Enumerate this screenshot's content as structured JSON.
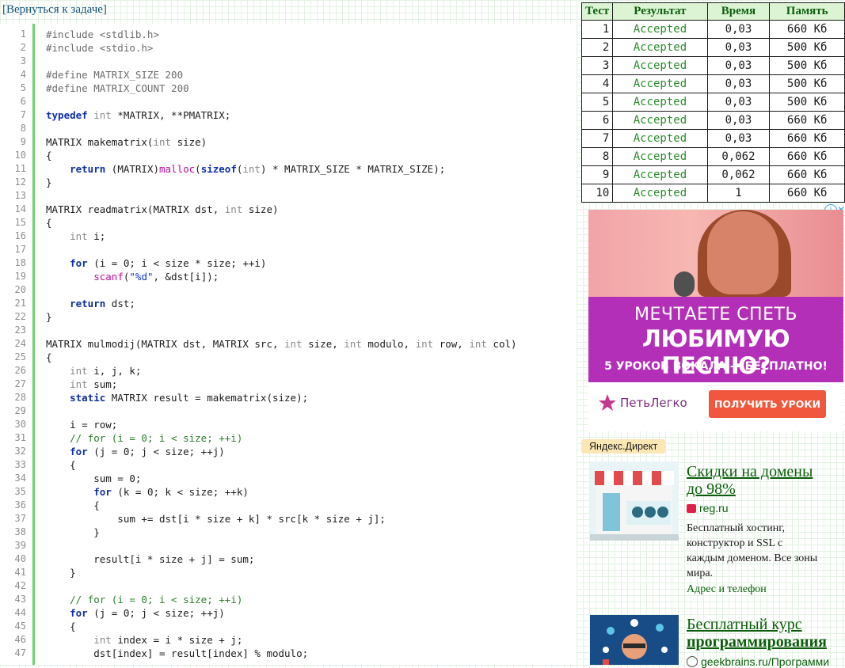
{
  "back_link": "[Вернуться к задаче]",
  "code": {
    "lines": [
      {
        "n": "1",
        "t": [
          {
            "c": "pp",
            "v": "#include <stdlib.h>"
          }
        ]
      },
      {
        "n": "2",
        "t": [
          {
            "c": "pp",
            "v": "#include <stdio.h>"
          }
        ]
      },
      {
        "n": "3",
        "t": []
      },
      {
        "n": "4",
        "t": [
          {
            "c": "pp",
            "v": "#define MATRIX_SIZE 200"
          }
        ]
      },
      {
        "n": "5",
        "t": [
          {
            "c": "pp",
            "v": "#define MATRIX_COUNT 200"
          }
        ]
      },
      {
        "n": "6",
        "t": []
      },
      {
        "n": "7",
        "t": [
          {
            "c": "kw",
            "v": "typedef"
          },
          {
            "c": "",
            "v": " "
          },
          {
            "c": "ty",
            "v": "int"
          },
          {
            "c": "",
            "v": " *MATRIX, **PMATRIX;"
          }
        ]
      },
      {
        "n": "8",
        "t": []
      },
      {
        "n": "9",
        "t": [
          {
            "c": "",
            "v": "MATRIX makematrix("
          },
          {
            "c": "ty",
            "v": "int"
          },
          {
            "c": "",
            "v": " size)"
          }
        ]
      },
      {
        "n": "10",
        "t": [
          {
            "c": "",
            "v": "{"
          }
        ]
      },
      {
        "n": "11",
        "t": [
          {
            "c": "",
            "v": "    "
          },
          {
            "c": "kw",
            "v": "return"
          },
          {
            "c": "",
            "v": " (MATRIX)"
          },
          {
            "c": "fn",
            "v": "malloc"
          },
          {
            "c": "",
            "v": "("
          },
          {
            "c": "kw",
            "v": "sizeof"
          },
          {
            "c": "",
            "v": "("
          },
          {
            "c": "ty",
            "v": "int"
          },
          {
            "c": "",
            "v": ") * MATRIX_SIZE * MATRIX_SIZE);"
          }
        ]
      },
      {
        "n": "12",
        "t": [
          {
            "c": "",
            "v": "}"
          }
        ]
      },
      {
        "n": "13",
        "t": []
      },
      {
        "n": "14",
        "t": [
          {
            "c": "",
            "v": "MATRIX readmatrix(MATRIX dst, "
          },
          {
            "c": "ty",
            "v": "int"
          },
          {
            "c": "",
            "v": " size)"
          }
        ]
      },
      {
        "n": "15",
        "t": [
          {
            "c": "",
            "v": "{"
          }
        ]
      },
      {
        "n": "16",
        "t": [
          {
            "c": "",
            "v": "    "
          },
          {
            "c": "ty",
            "v": "int"
          },
          {
            "c": "",
            "v": " i;"
          }
        ]
      },
      {
        "n": "17",
        "t": []
      },
      {
        "n": "18",
        "t": [
          {
            "c": "",
            "v": "    "
          },
          {
            "c": "kw",
            "v": "for"
          },
          {
            "c": "",
            "v": " (i = 0; i < size * size; ++i)"
          }
        ]
      },
      {
        "n": "19",
        "t": [
          {
            "c": "",
            "v": "        "
          },
          {
            "c": "fn",
            "v": "scanf"
          },
          {
            "c": "",
            "v": "("
          },
          {
            "c": "str",
            "v": "\"%d\""
          },
          {
            "c": "",
            "v": ", &dst[i]);"
          }
        ]
      },
      {
        "n": "20",
        "t": []
      },
      {
        "n": "21",
        "t": [
          {
            "c": "",
            "v": "    "
          },
          {
            "c": "kw",
            "v": "return"
          },
          {
            "c": "",
            "v": " dst;"
          }
        ]
      },
      {
        "n": "22",
        "t": [
          {
            "c": "",
            "v": "}"
          }
        ]
      },
      {
        "n": "23",
        "t": []
      },
      {
        "n": "24",
        "t": [
          {
            "c": "",
            "v": "MATRIX mulmodij(MATRIX dst, MATRIX src, "
          },
          {
            "c": "ty",
            "v": "int"
          },
          {
            "c": "",
            "v": " size, "
          },
          {
            "c": "ty",
            "v": "int"
          },
          {
            "c": "",
            "v": " modulo, "
          },
          {
            "c": "ty",
            "v": "int"
          },
          {
            "c": "",
            "v": " row, "
          },
          {
            "c": "ty",
            "v": "int"
          },
          {
            "c": "",
            "v": " col)"
          }
        ]
      },
      {
        "n": "25",
        "t": [
          {
            "c": "",
            "v": "{"
          }
        ]
      },
      {
        "n": "26",
        "t": [
          {
            "c": "",
            "v": "    "
          },
          {
            "c": "ty",
            "v": "int"
          },
          {
            "c": "",
            "v": " i, j, k;"
          }
        ]
      },
      {
        "n": "27",
        "t": [
          {
            "c": "",
            "v": "    "
          },
          {
            "c": "ty",
            "v": "int"
          },
          {
            "c": "",
            "v": " sum;"
          }
        ]
      },
      {
        "n": "28",
        "t": [
          {
            "c": "",
            "v": "    "
          },
          {
            "c": "kw",
            "v": "static"
          },
          {
            "c": "",
            "v": " MATRIX result = makematrix(size);"
          }
        ]
      },
      {
        "n": "29",
        "t": []
      },
      {
        "n": "30",
        "t": [
          {
            "c": "",
            "v": "    i = row;"
          }
        ]
      },
      {
        "n": "31",
        "t": [
          {
            "c": "",
            "v": "    "
          },
          {
            "c": "cm",
            "v": "// for (i = 0; i < size; ++i)"
          }
        ]
      },
      {
        "n": "32",
        "t": [
          {
            "c": "",
            "v": "    "
          },
          {
            "c": "kw",
            "v": "for"
          },
          {
            "c": "",
            "v": " (j = 0; j < size; ++j)"
          }
        ]
      },
      {
        "n": "33",
        "t": [
          {
            "c": "",
            "v": "    {"
          }
        ]
      },
      {
        "n": "34",
        "t": [
          {
            "c": "",
            "v": "        sum = 0;"
          }
        ]
      },
      {
        "n": "35",
        "t": [
          {
            "c": "",
            "v": "        "
          },
          {
            "c": "kw",
            "v": "for"
          },
          {
            "c": "",
            "v": " (k = 0; k < size; ++k)"
          }
        ]
      },
      {
        "n": "36",
        "t": [
          {
            "c": "",
            "v": "        {"
          }
        ]
      },
      {
        "n": "37",
        "t": [
          {
            "c": "",
            "v": "            sum += dst[i * size + k] * src[k * size + j];"
          }
        ]
      },
      {
        "n": "38",
        "t": [
          {
            "c": "",
            "v": "        }"
          }
        ]
      },
      {
        "n": "39",
        "t": []
      },
      {
        "n": "40",
        "t": [
          {
            "c": "",
            "v": "        result[i * size + j] = sum;"
          }
        ]
      },
      {
        "n": "41",
        "t": [
          {
            "c": "",
            "v": "    }"
          }
        ]
      },
      {
        "n": "42",
        "t": []
      },
      {
        "n": "43",
        "t": [
          {
            "c": "",
            "v": "    "
          },
          {
            "c": "cm",
            "v": "// for (i = 0; i < size; ++i)"
          }
        ]
      },
      {
        "n": "44",
        "t": [
          {
            "c": "",
            "v": "    "
          },
          {
            "c": "kw",
            "v": "for"
          },
          {
            "c": "",
            "v": " (j = 0; j < size; ++j)"
          }
        ]
      },
      {
        "n": "45",
        "t": [
          {
            "c": "",
            "v": "    {"
          }
        ]
      },
      {
        "n": "46",
        "t": [
          {
            "c": "",
            "v": "        "
          },
          {
            "c": "ty",
            "v": "int"
          },
          {
            "c": "",
            "v": " index = i * size + j;"
          }
        ]
      },
      {
        "n": "47",
        "t": [
          {
            "c": "",
            "v": "        dst[index] = result[index] % modulo;"
          }
        ]
      }
    ]
  },
  "results": {
    "headers": [
      "Тест",
      "Результат",
      "Время",
      "Память"
    ],
    "rows": [
      [
        "1",
        "Accepted",
        "0,03",
        "660 Кб"
      ],
      [
        "2",
        "Accepted",
        "0,03",
        "500 Кб"
      ],
      [
        "3",
        "Accepted",
        "0,03",
        "500 Кб"
      ],
      [
        "4",
        "Accepted",
        "0,03",
        "500 Кб"
      ],
      [
        "5",
        "Accepted",
        "0,03",
        "500 Кб"
      ],
      [
        "6",
        "Accepted",
        "0,03",
        "660 Кб"
      ],
      [
        "7",
        "Accepted",
        "0,03",
        "660 Кб"
      ],
      [
        "8",
        "Accepted",
        "0,062",
        "660 Кб"
      ],
      [
        "9",
        "Accepted",
        "0,062",
        "660 Кб"
      ],
      [
        "10",
        "Accepted",
        "1",
        "660 Кб"
      ]
    ]
  },
  "ad": {
    "line1": "МЕЧТАЕТЕ СПЕТЬ",
    "line2": "ЛЮБИМУЮ ПЕСНЮ?",
    "line3": "5 УРОКОВ ВОКАЛА — БЕСПЛАТНО!",
    "brand": "ПетьЛегко",
    "cta": "ПОЛУЧИТЬ УРОКИ",
    "info_icon": "i",
    "close_icon": "✕"
  },
  "direct": {
    "label": "Яндекс.Директ",
    "ads": [
      {
        "title_line1": "Скидки на домены",
        "title_line2": "до 98%",
        "domain": "reg.ru",
        "text_lines": [
          "Бесплатный хостинг,",
          "конструктор и SSL с",
          "каждым доменом. Все зоны",
          "мира."
        ],
        "extra": "Адрес и телефон"
      },
      {
        "title_line1": "Бесплатный курс",
        "title_line2": "программирования",
        "domain": "geekbrains.ru/Программи"
      }
    ]
  },
  "colors": {
    "accent_green": "#0b5d0b",
    "accepted": "#2d8a2d",
    "header_bg": "#dcf4d4",
    "gutter": "#6dd36d",
    "ad_purple": "#b42fb8",
    "cta": "#f0573c"
  }
}
